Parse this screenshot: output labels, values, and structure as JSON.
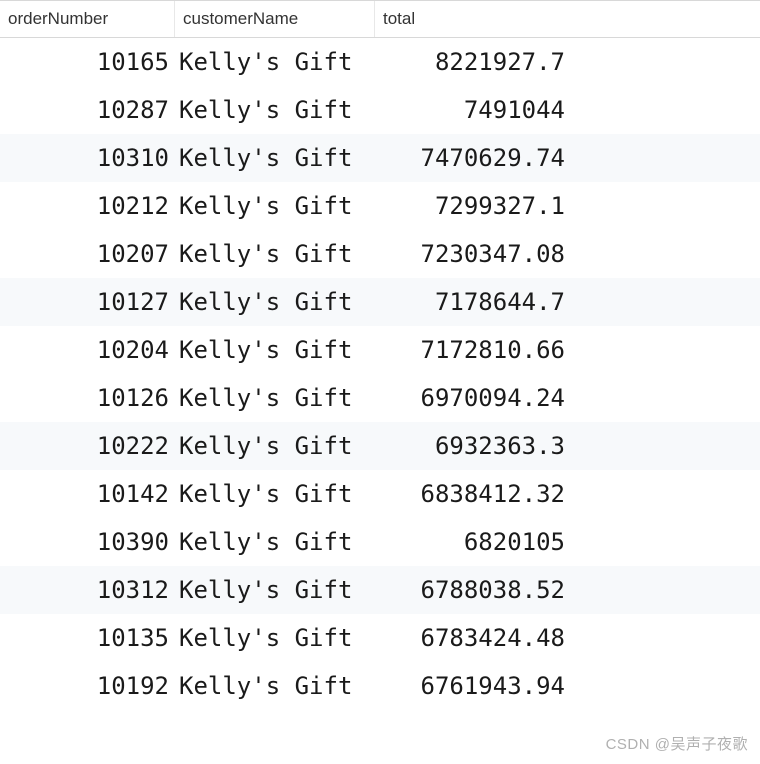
{
  "headers": {
    "orderNumber": "orderNumber",
    "customerName": "customerName",
    "total": "total"
  },
  "rows": [
    {
      "orderNumber": "10165",
      "customerName": "Kelly's Gift",
      "total": "8221927.7"
    },
    {
      "orderNumber": "10287",
      "customerName": "Kelly's Gift",
      "total": "7491044"
    },
    {
      "orderNumber": "10310",
      "customerName": "Kelly's Gift",
      "total": "7470629.74"
    },
    {
      "orderNumber": "10212",
      "customerName": "Kelly's Gift",
      "total": "7299327.1"
    },
    {
      "orderNumber": "10207",
      "customerName": "Kelly's Gift",
      "total": "7230347.08"
    },
    {
      "orderNumber": "10127",
      "customerName": "Kelly's Gift",
      "total": "7178644.7"
    },
    {
      "orderNumber": "10204",
      "customerName": "Kelly's Gift",
      "total": "7172810.66"
    },
    {
      "orderNumber": "10126",
      "customerName": "Kelly's Gift",
      "total": "6970094.24"
    },
    {
      "orderNumber": "10222",
      "customerName": "Kelly's Gift",
      "total": "6932363.3"
    },
    {
      "orderNumber": "10142",
      "customerName": "Kelly's Gift",
      "total": "6838412.32"
    },
    {
      "orderNumber": "10390",
      "customerName": "Kelly's Gift",
      "total": "6820105"
    },
    {
      "orderNumber": "10312",
      "customerName": "Kelly's Gift",
      "total": "6788038.52"
    },
    {
      "orderNumber": "10135",
      "customerName": "Kelly's Gift",
      "total": "6783424.48"
    },
    {
      "orderNumber": "10192",
      "customerName": "Kelly's Gift",
      "total": "6761943.94"
    }
  ],
  "stripeIndices": [
    2,
    5,
    8,
    11
  ],
  "watermark": "CSDN @吴声子夜歌"
}
